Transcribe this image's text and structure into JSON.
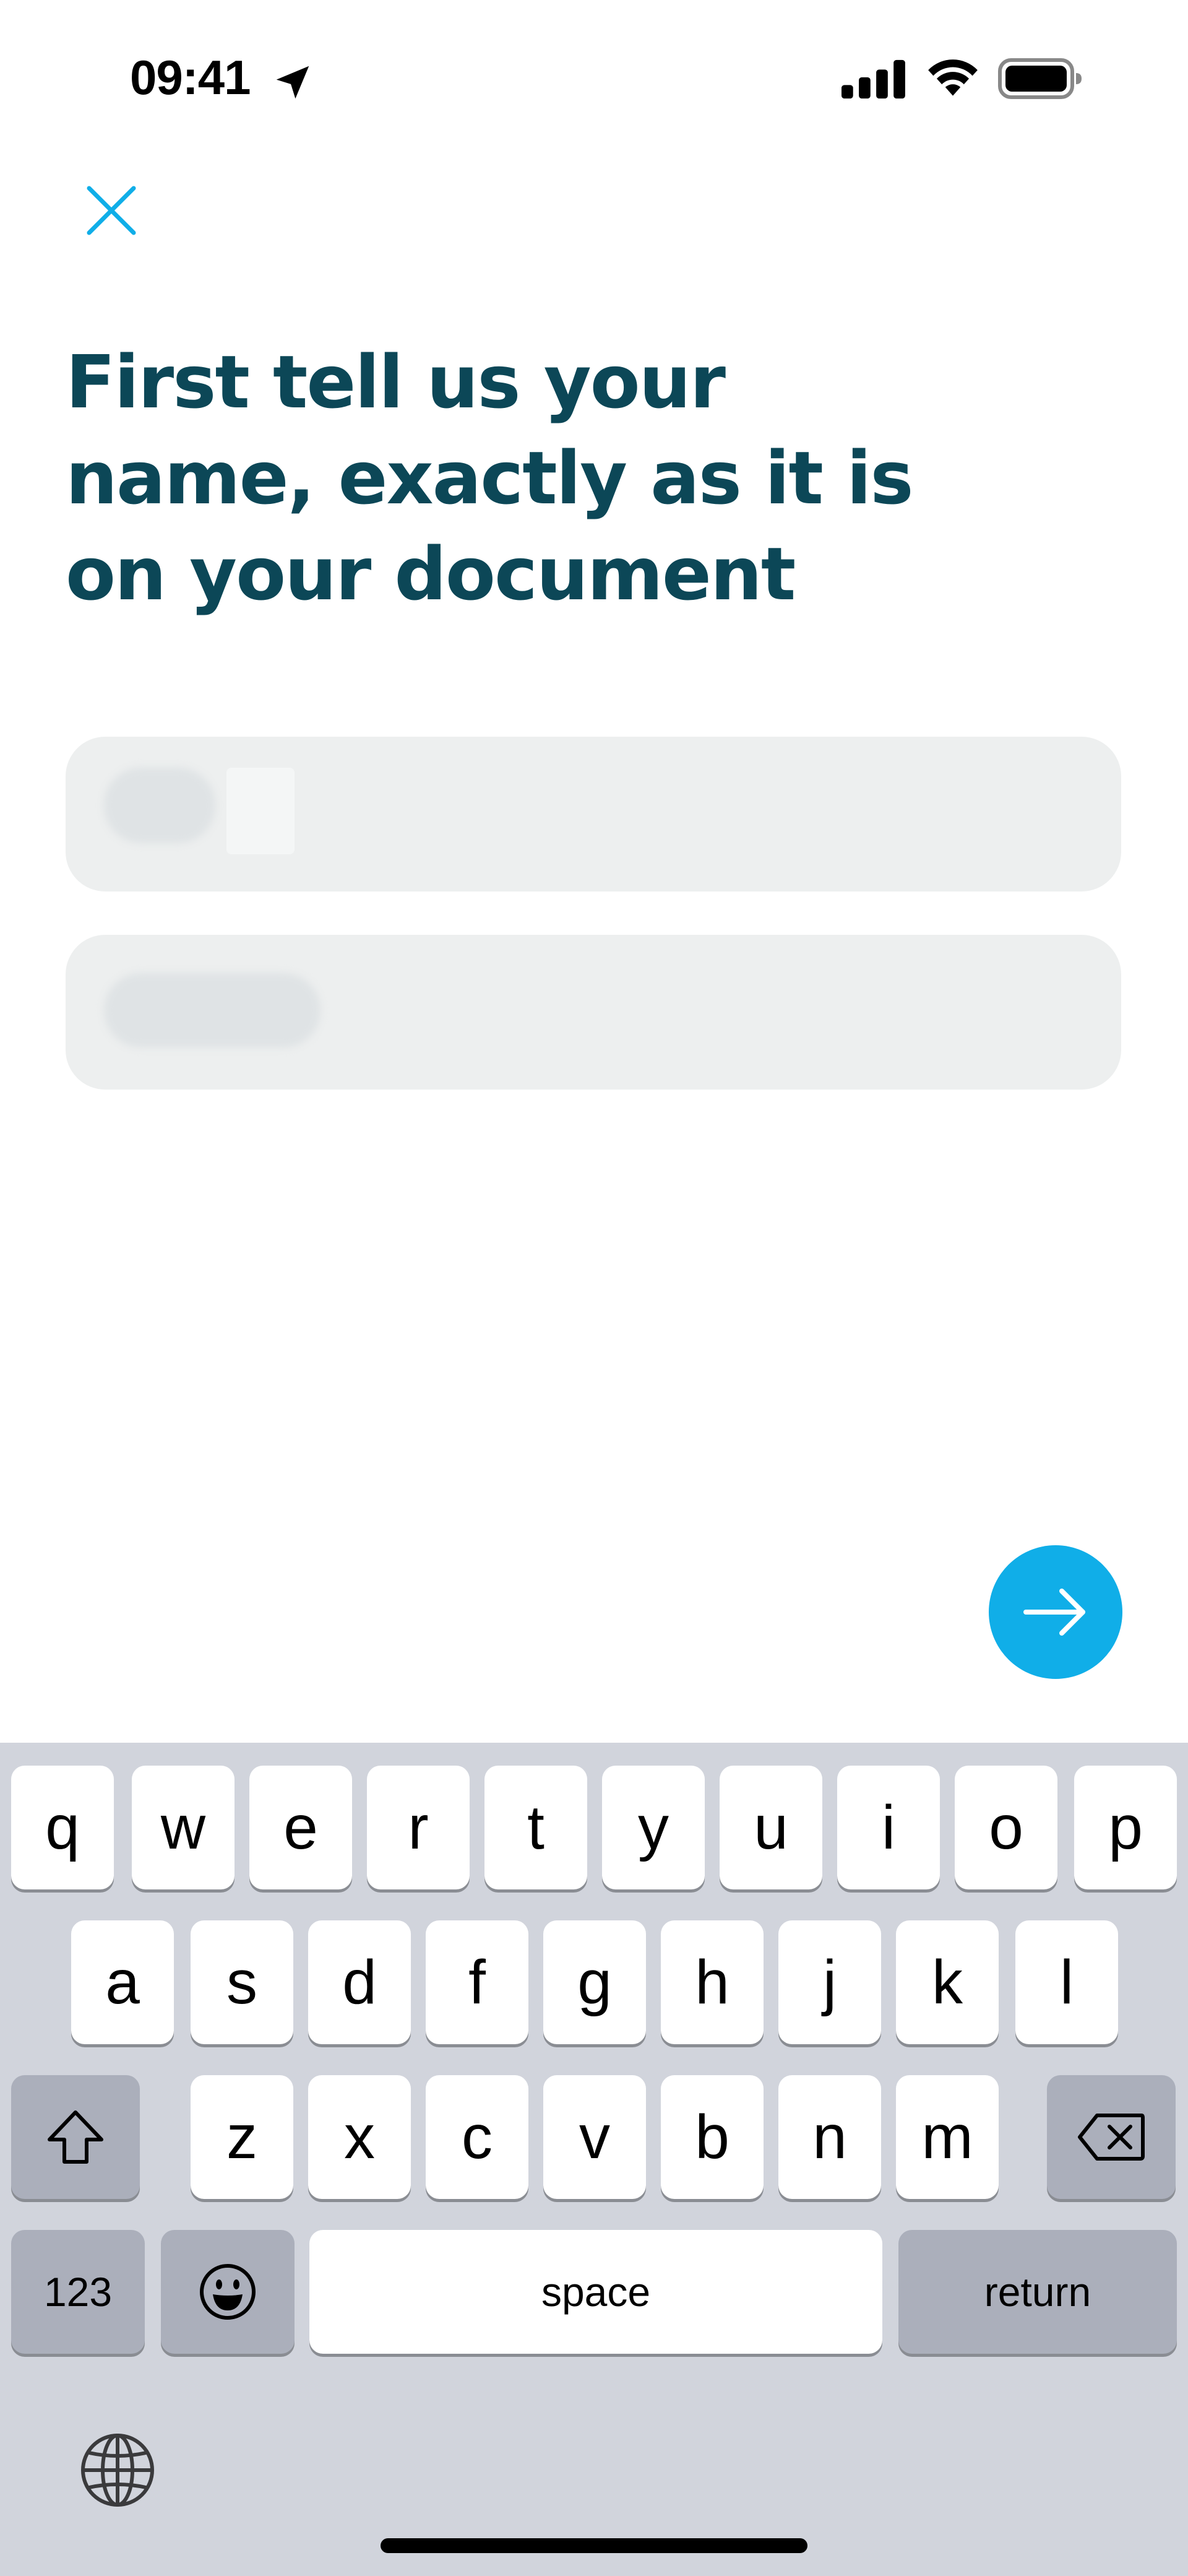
{
  "status_bar": {
    "time": "09:41",
    "icons": [
      "location-arrow-icon",
      "cellular-signal-icon",
      "wifi-icon",
      "battery-icon"
    ]
  },
  "close_icon": "close-icon",
  "title": "First tell us your name, exactly as it is on your document",
  "fields": [
    {
      "value": "",
      "placeholder": ""
    },
    {
      "value": "",
      "placeholder": ""
    }
  ],
  "next_icon": "arrow-right-icon",
  "keyboard": {
    "row1": [
      "q",
      "w",
      "e",
      "r",
      "t",
      "y",
      "u",
      "i",
      "o",
      "p"
    ],
    "row2": [
      "a",
      "s",
      "d",
      "f",
      "g",
      "h",
      "j",
      "k",
      "l"
    ],
    "row3": [
      "z",
      "x",
      "c",
      "v",
      "b",
      "n",
      "m"
    ],
    "numbers_label": "123",
    "space_label": "space",
    "return_label": "return",
    "shift_icon": "shift-icon",
    "delete_icon": "backspace-icon",
    "emoji_icon": "emoji-icon",
    "globe_icon": "globe-icon"
  },
  "colors": {
    "title": "#0c4757",
    "accent": "#10aee8",
    "field_bg": "#edefef",
    "keyboard_bg": "#d1d4dc"
  }
}
